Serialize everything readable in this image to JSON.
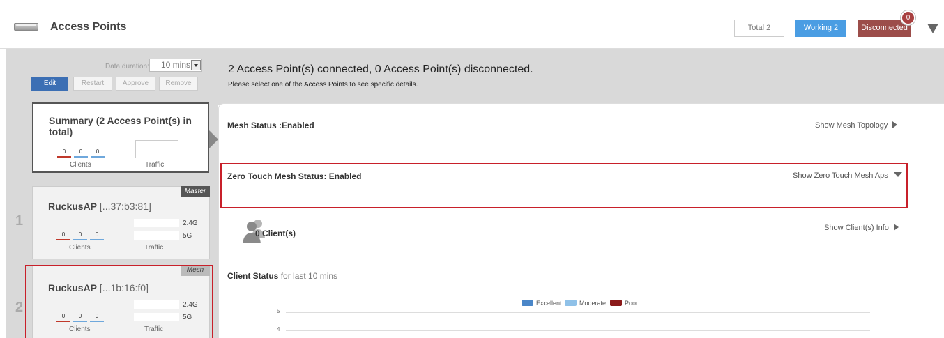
{
  "header": {
    "title": "Access Points",
    "total_label": "Total 2",
    "working_label": "Working 2",
    "disconnected_label": "Disconnected",
    "notification_count": "0"
  },
  "left": {
    "data_duration_label": "Data duration:",
    "data_duration_value": "10 mins",
    "buttons": {
      "edit": "Edit",
      "restart": "Restart",
      "approve": "Approve",
      "remove": "Remove"
    },
    "summary": {
      "title": "Summary (2 Access Point(s) in total)",
      "stats": [
        "0",
        "0",
        "0"
      ],
      "clients_label": "Clients",
      "traffic_label": "Traffic"
    },
    "aps": [
      {
        "row": "1",
        "name": "RuckusAP",
        "mac": " [...37:b3:81]",
        "tag": "Master",
        "stats": [
          "0",
          "0",
          "0"
        ],
        "band1": "2.4G",
        "band2": "5G",
        "clients_label": "Clients",
        "traffic_label": "Traffic"
      },
      {
        "row": "2",
        "name": "RuckusAP",
        "mac": " [...1b:16:f0]",
        "tag": "Mesh",
        "stats": [
          "0",
          "0",
          "0"
        ],
        "band1": "2.4G",
        "band2": "5G",
        "clients_label": "Clients",
        "traffic_label": "Traffic"
      }
    ]
  },
  "main": {
    "connection_summary": "2 Access Point(s) connected, 0 Access Point(s) disconnected.",
    "hint": "Please select one of the Access Points to see specific details.",
    "mesh_status": "Mesh Status :Enabled",
    "show_mesh_topology": "Show Mesh Topology",
    "zero_touch_status": "Zero Touch Mesh Status: Enabled",
    "show_zero_touch": "Show Zero Touch Mesh Aps",
    "clients": "0 Client(s)",
    "show_clients": "Show Client(s) Info",
    "client_status_title": "Client Status",
    "client_status_period": "for last 10 mins"
  },
  "chart_data": {
    "type": "bar",
    "title": "",
    "legend": [
      {
        "name": "Excellent",
        "color": "#4a86c8"
      },
      {
        "name": "Moderate",
        "color": "#8fc1e8"
      },
      {
        "name": "Poor",
        "color": "#8b1a1a"
      }
    ],
    "y_ticks": [
      "5",
      "4"
    ],
    "legend_placement": "top-center",
    "grid": true
  },
  "colors": {
    "accent_blue": "#4a9de3",
    "edit_blue": "#3c6fb4",
    "disconnected": "#9c4d4a",
    "highlight_red": "#c8202a",
    "stat_red": "#c0392b",
    "stat_blue": "#6fa8dc"
  }
}
